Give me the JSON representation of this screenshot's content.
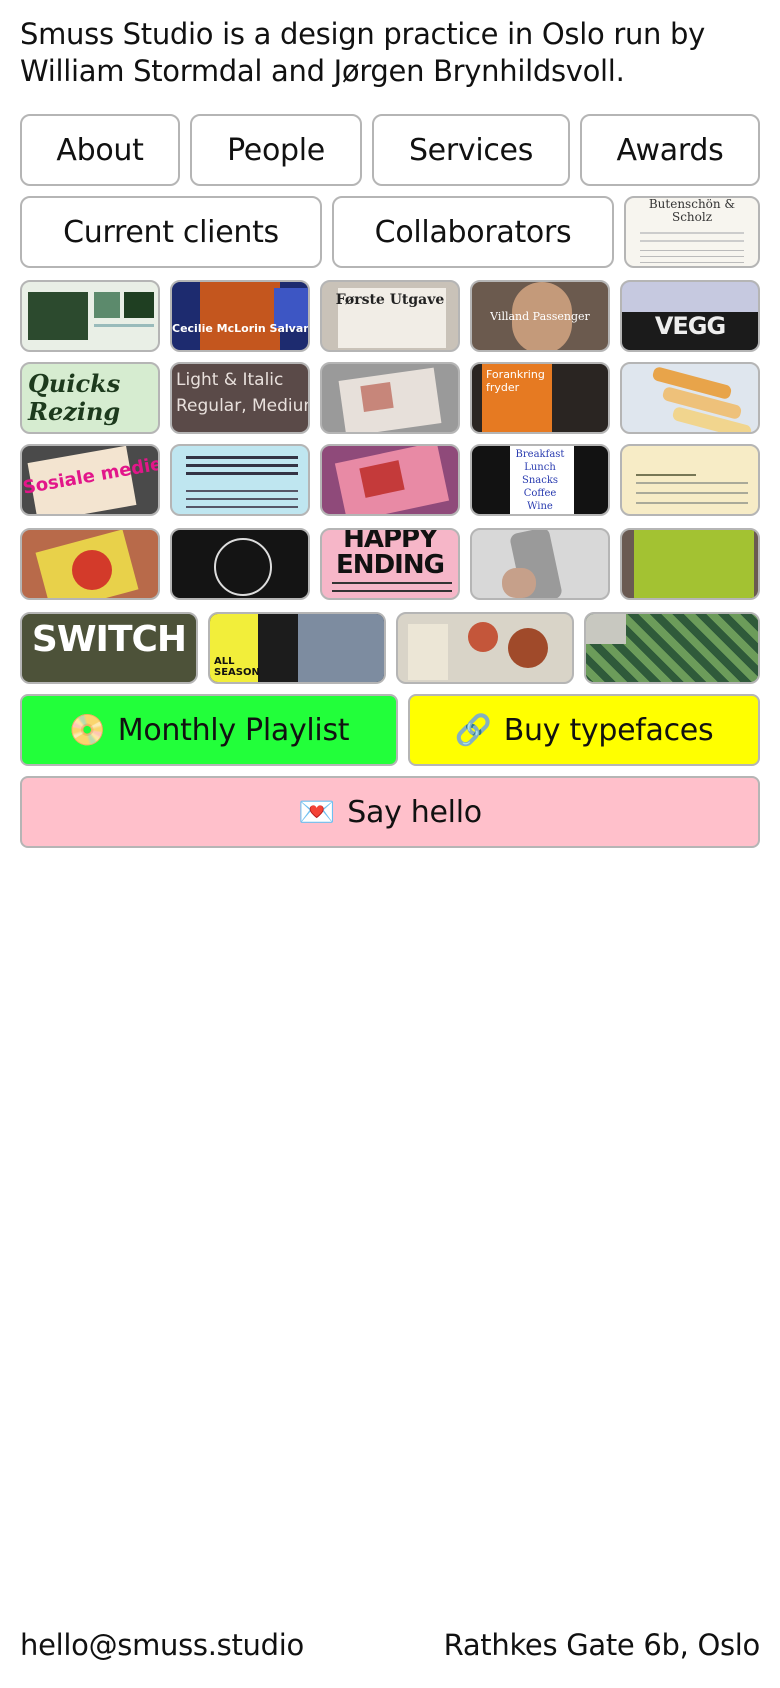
{
  "intro": "Smuss Studio is a design practice in Oslo run by William Stormdal and Jørgen Brynhildsvoll.",
  "nav": {
    "about": "About",
    "people": "People",
    "services": "Services",
    "awards": "Awards",
    "current_clients": "Current clients",
    "collaborators": "Collaborators"
  },
  "thumbnails": {
    "butenschon": "Butenschön & Scholz",
    "cecilie": "Cecilie McLorin Salvant",
    "forste_utgave": "Første Utgave",
    "villand": "Villand Passenger",
    "vegg": "VEGG",
    "quicks_rezing": "Quicks Rezing",
    "light_italic": "Light & Italic",
    "regular_medium": "Regular, Medium",
    "forankring": "Forankring fryder",
    "sosiale_medier": "Sosiale medier",
    "breakfast": [
      "Breakfast",
      "Lunch",
      "Snacks",
      "Coffee",
      "Wine"
    ],
    "happy_ending": "HAPPY ENDING",
    "switch": "SWITCH",
    "all_season": "ALL SEASON"
  },
  "cta": {
    "playlist": {
      "icon": "📀",
      "label": "Monthly Playlist",
      "color": "#22ff3a"
    },
    "typefaces": {
      "icon": "🔗",
      "label": "Buy typefaces",
      "color": "#ffff00"
    },
    "hello": {
      "icon": "💌",
      "label": "Say hello",
      "color": "#ffc0cb"
    }
  },
  "footer": {
    "email": "hello@smuss.studio",
    "address": "Rathkes Gate 6b, Oslo"
  }
}
